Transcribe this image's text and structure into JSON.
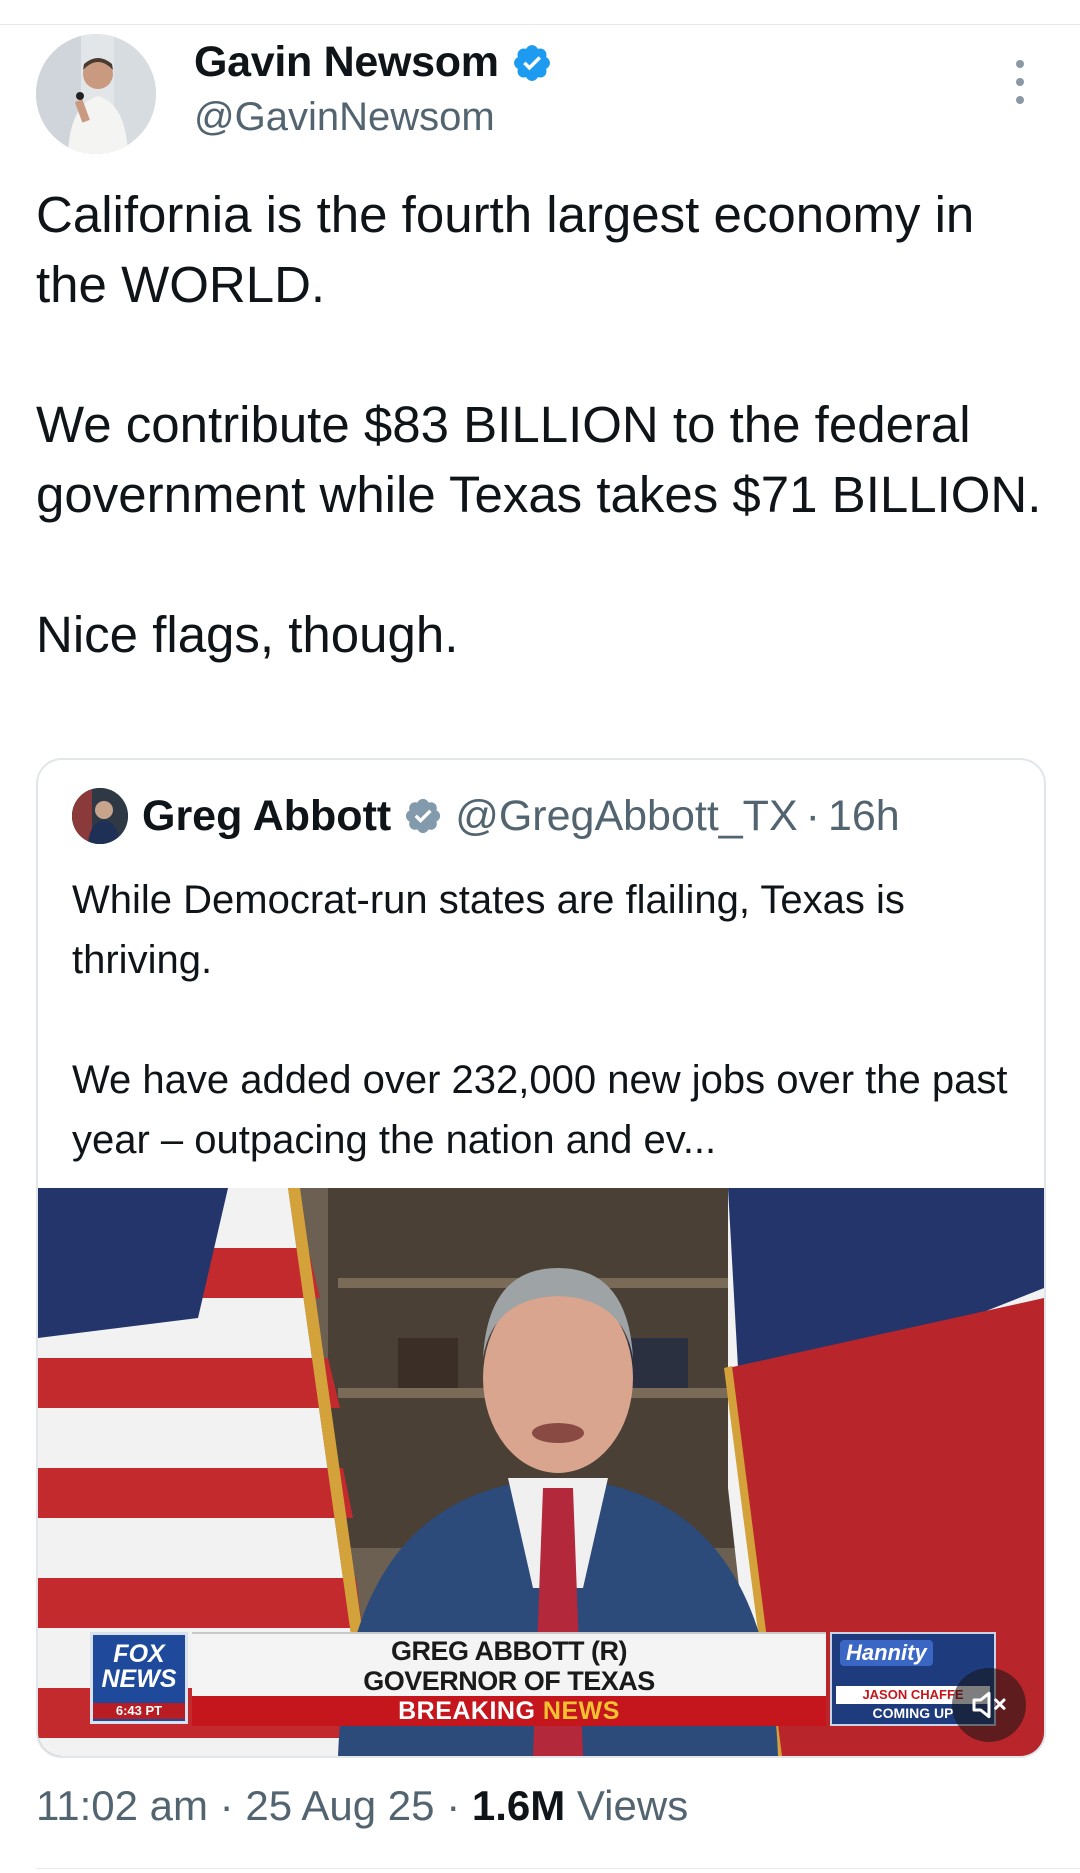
{
  "tweet": {
    "author_name": "Gavin Newsom",
    "author_handle": "@GavinNewsom",
    "text": "California is the fourth largest economy in the WORLD.\n\nWe contribute $83 BILLION to the federal government while Texas takes $71 BILLION.\n\nNice flags, though.",
    "timestamp": "11:02 am",
    "date": "25 Aug 25",
    "views_count": "1.6M",
    "views_label": "Views",
    "separator": "·"
  },
  "quote": {
    "author_name": "Greg Abbott",
    "author_handle": "@GregAbbott_TX",
    "separator": "·",
    "time_ago": "16h",
    "text": "While Democrat-run states are flailing, Texas is thriving.\n\nWe have added over 232,000 new jobs over the past year – outpacing the nation and ev..."
  },
  "video_overlay": {
    "network_logo_line1": "FOX",
    "network_logo_line2": "NEWS",
    "clock": "6:43 PT",
    "name_line": "GREG ABBOTT (R)",
    "title_line": "GOVERNOR OF TEXAS",
    "breaking_word": "BREAKING",
    "news_word": "NEWS",
    "show_logo": "Hannity",
    "up_next_name": "JASON CHAFFE",
    "up_next_label": "COMING UP"
  },
  "colors": {
    "verified_blue": "#1d9bf0",
    "verified_gray": "#829aab",
    "text_primary": "#0f1419",
    "text_secondary": "#536471",
    "breaking_red": "#c4161c",
    "news_yellow": "#f2c230"
  },
  "icons": {
    "verified": "verified-badge-icon",
    "more": "more-options-icon",
    "mute": "muted-speaker-icon"
  }
}
